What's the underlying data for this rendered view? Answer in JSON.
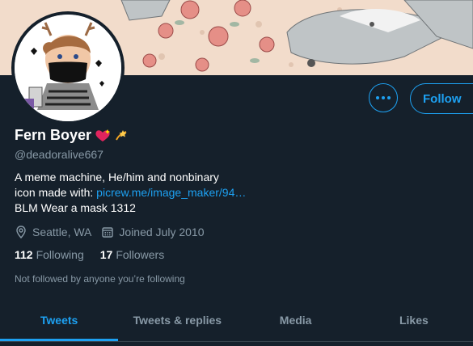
{
  "profile": {
    "name": "Fern Boyer",
    "handle": "@deadoralive667",
    "bio": {
      "line1": "A meme machine, He/him and nonbinary",
      "line2_prefix": "icon made with: ",
      "line2_link": "picrew.me/image_maker/94…",
      "line3": "BLM Wear a mask 1312"
    },
    "location": "Seattle, WA",
    "joined": "Joined July 2010",
    "following_count": "112",
    "following_label": "Following",
    "followers_count": "17",
    "followers_label": "Followers",
    "followed_note": "Not followed by anyone you’re following"
  },
  "actions": {
    "follow_label": "Follow",
    "more_icon": "more-dots-icon"
  },
  "tabs": [
    {
      "label": "Tweets",
      "active": true
    },
    {
      "label": "Tweets & replies",
      "active": false
    },
    {
      "label": "Media",
      "active": false
    },
    {
      "label": "Likes",
      "active": false
    }
  ],
  "colors": {
    "background": "#15202b",
    "accent": "#1da1f2",
    "secondary_text": "#8899a6",
    "primary_text": "#ffffff"
  },
  "icons": {
    "name_emojis": [
      "heart-with-sparkle-icon",
      "dizzy-star-icon"
    ],
    "location": "location-pin-icon",
    "joined": "calendar-icon"
  }
}
